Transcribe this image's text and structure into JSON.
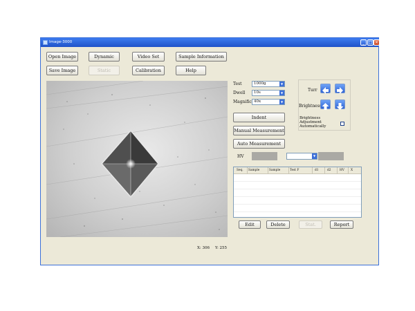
{
  "window": {
    "title": "Image-3000",
    "min_glyph": "_",
    "max_glyph": "□",
    "close_glyph": "×"
  },
  "toolbar": {
    "open_image": "Open Image",
    "dynamic": "Dynamic",
    "video_set": "Video Set",
    "sample_information": "Sample Information",
    "save_image": "Save Image",
    "static": "Static",
    "calibration": "Calibration",
    "help": "Help"
  },
  "viewer": {
    "x_readout": "X: 306",
    "y_readout": "Y: 255"
  },
  "settings": {
    "test_label": "Test",
    "test_value": "1000g",
    "dwell_label": "Dwell",
    "dwell_value": "10s",
    "magnific_label": "Magnific",
    "magnific_value": "40x"
  },
  "actions": {
    "indent": "Indent",
    "manual_measurement": "Manual Measurement",
    "auto_measurement": "Auto Measurement"
  },
  "turret": {
    "label": "Turr"
  },
  "brightness": {
    "label": "Brightness",
    "auto_label": "Brightness Adjustment Automatically",
    "auto_checked": false
  },
  "hv": {
    "label": "HV",
    "value": "",
    "dropdown_value": ""
  },
  "table": {
    "columns": [
      "Seq.",
      "Sample",
      "Sample",
      "Test F",
      "d1",
      "d2",
      "HV",
      "X"
    ],
    "rows": []
  },
  "bottom": {
    "edit": "Edit",
    "delete": "Delete",
    "stat": "Stat.",
    "report": "Report"
  }
}
